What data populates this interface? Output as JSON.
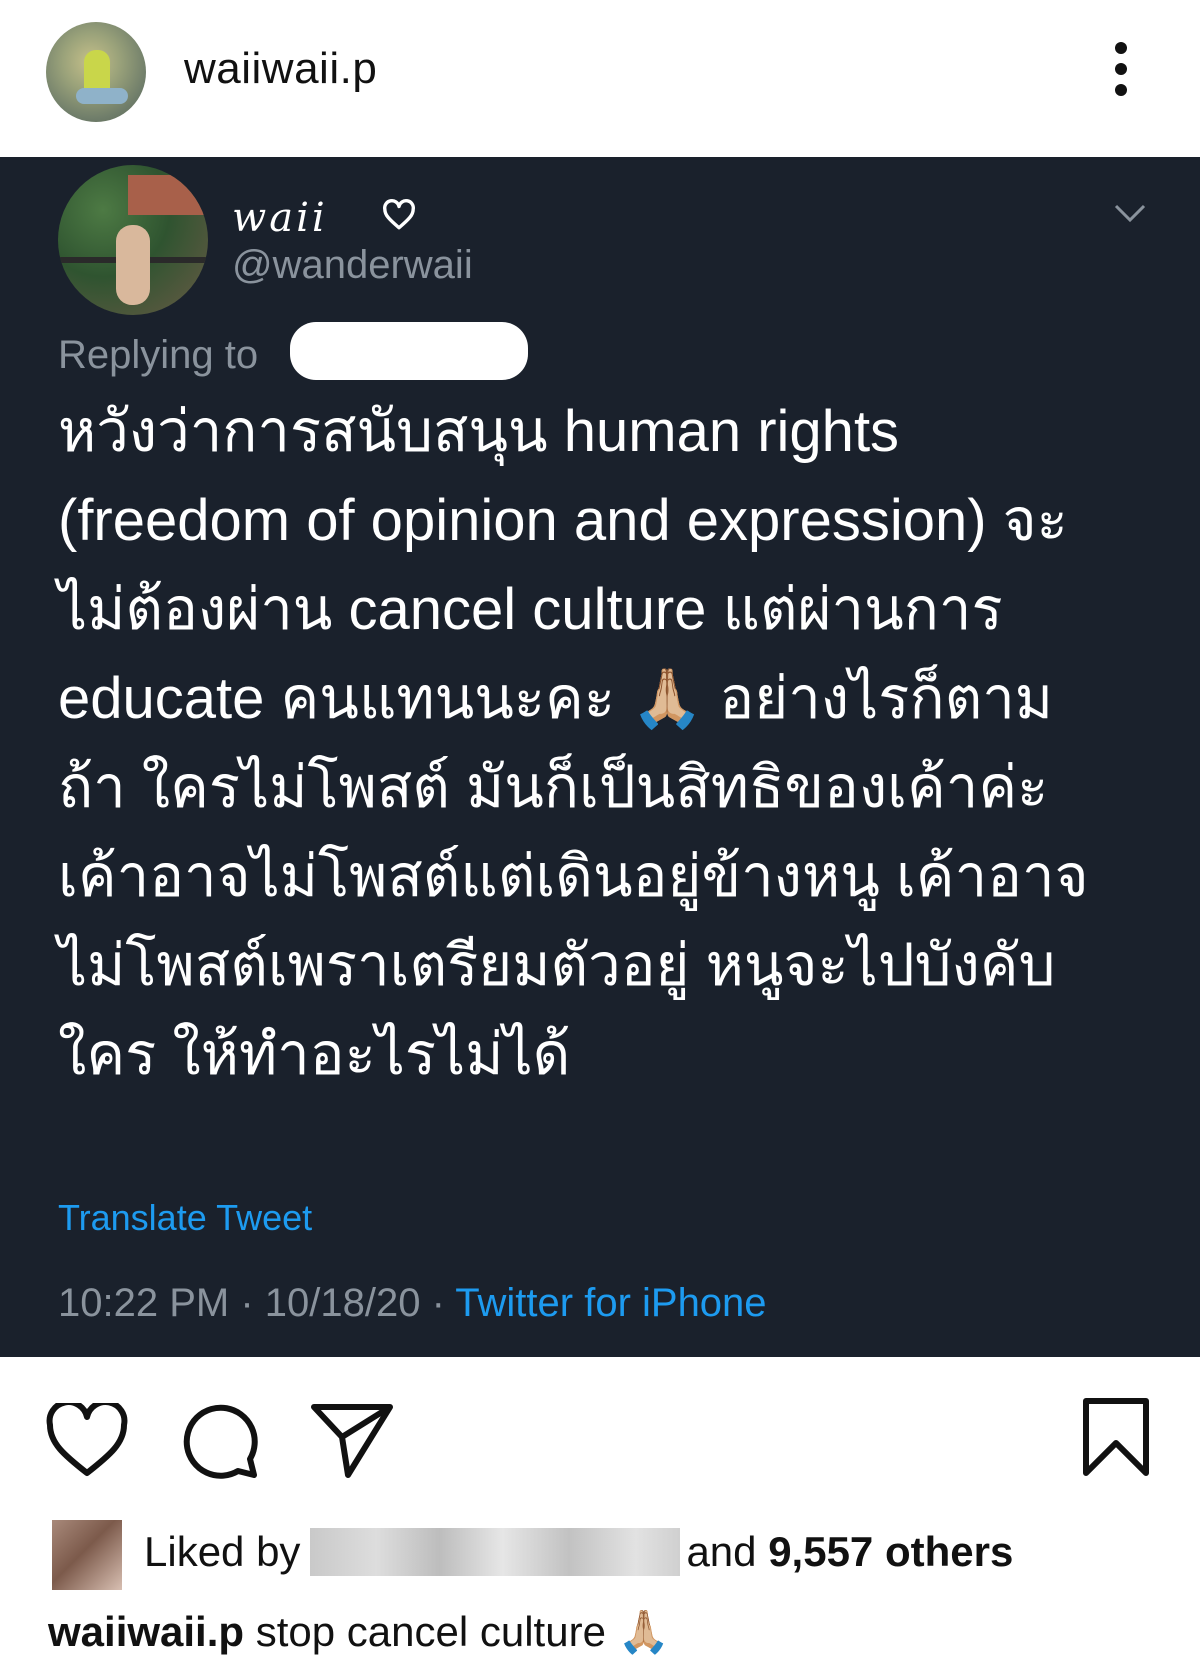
{
  "post": {
    "username": "waiiwaii.p"
  },
  "tweet": {
    "display_name": "waii",
    "handle": "@wanderwaii",
    "replying_to_label": "Replying to",
    "body_lines": [
      "หวังว่าการสนับสนุน human rights",
      "(freedom of opinion and expression) จะ",
      "ไม่ต้องผ่าน cancel culture แต่ผ่านการ",
      "educate คนแทนนะคะ 🙏🏼 อย่างไรก็ตาม",
      "ถ้า ใครไม่โพสต์ มันก็เป็นสิทธิของเค้าค่ะ",
      "เค้าอาจไม่โพสต์แต่เดินอยู่ข้างหนู เค้าอาจ",
      "ไม่โพสต์เพราเตรียมตัวอยู่ หนูจะไปบังคับ",
      "ใคร ให้ทำอะไรไม่ได้"
    ],
    "translate_label": "Translate Tweet",
    "timestamp": "10:22 PM · 10/18/20 ·",
    "client": "Twitter for iPhone"
  },
  "likes": {
    "prefix": "Liked by",
    "and_label": "and",
    "count_label": "9,557 others"
  },
  "caption": {
    "username": "waiiwaii.p",
    "text": "stop cancel culture 🙏🏼"
  },
  "icons": [
    "more-vertical-icon",
    "heart-icon",
    "chevron-down-icon",
    "like-icon",
    "comment-icon",
    "share-icon",
    "bookmark-icon"
  ],
  "colors": {
    "tweet_background": "#1a212c",
    "link_blue": "#1d9bf0",
    "muted_gray": "#8a939d"
  }
}
